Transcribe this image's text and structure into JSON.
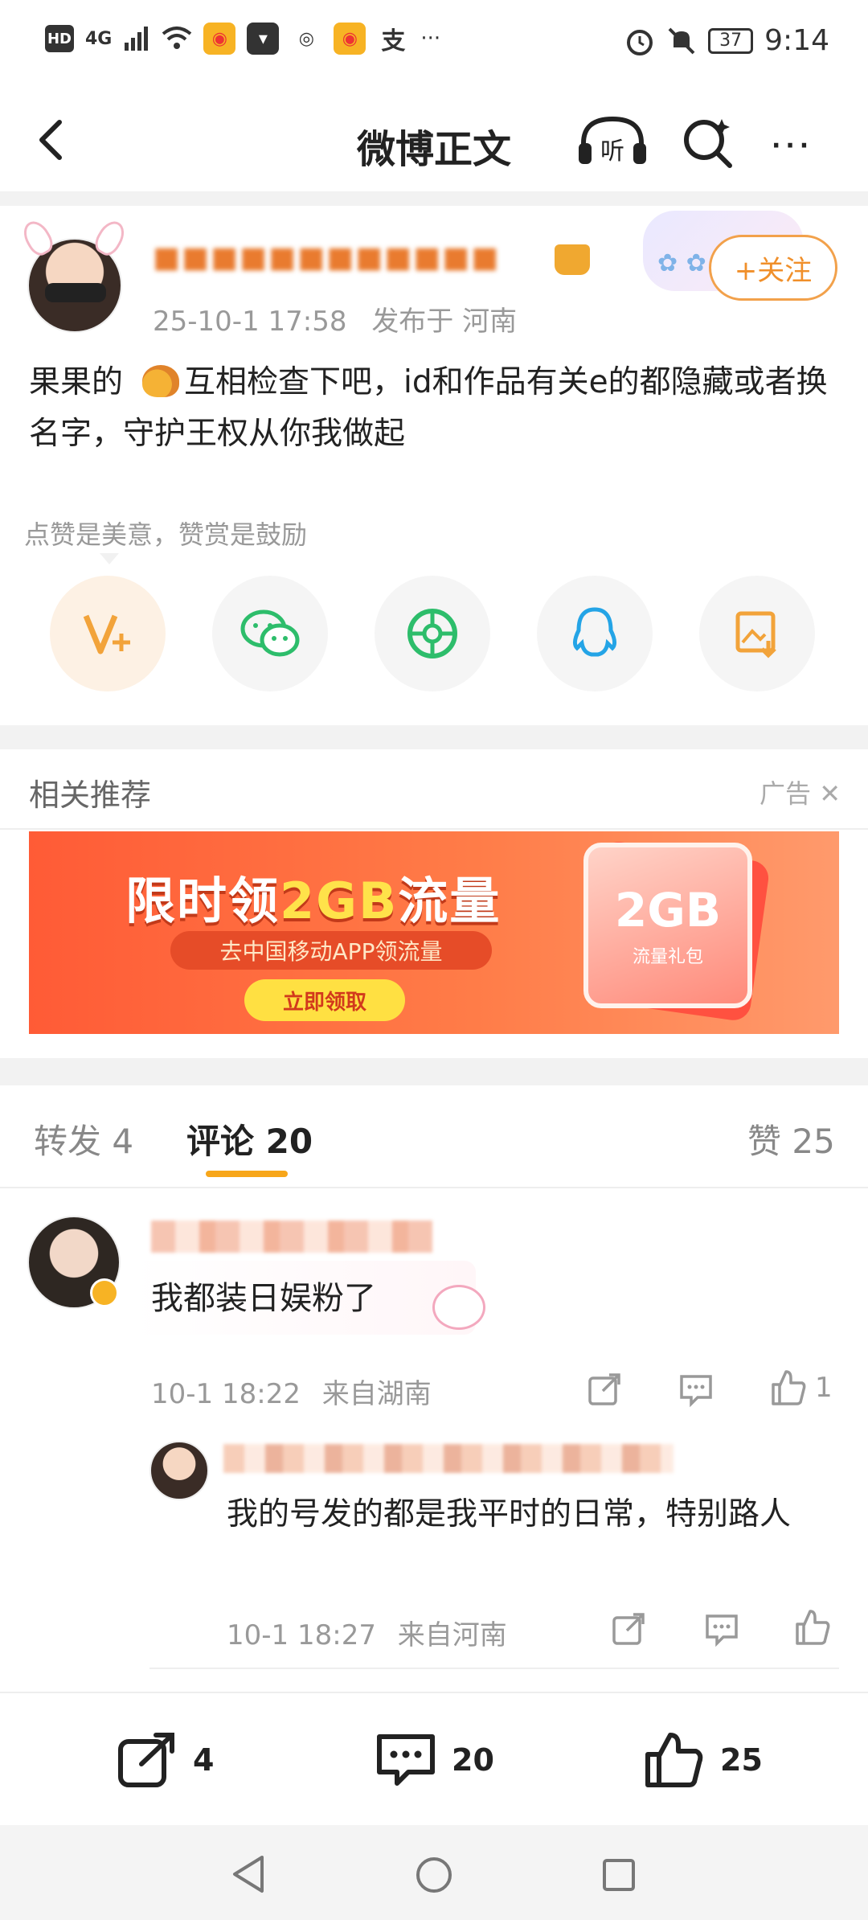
{
  "status_bar": {
    "network": "4G",
    "hd": "HD",
    "battery": "37",
    "time": "9:14",
    "overflow": "···"
  },
  "nav": {
    "title": "微博正文",
    "listen_label": "听",
    "more": "···"
  },
  "post": {
    "meta_time": "25-10-1 17:58",
    "meta_location": "发布于 河南",
    "follow_label": "+关注",
    "text_prefix": "果果的",
    "text_rest": "互相检查下吧，id和作品有关e的都隐藏或者换名字，守护王权从你我做起",
    "tip": "点赞是美意，赞赏是鼓励"
  },
  "recommend": {
    "title": "相关推荐",
    "ad_label": "广告",
    "banner": {
      "title_part1": "限时领",
      "title_highlight": "2GB",
      "title_part2": "流量",
      "subtitle": "去中国移动APP领流量",
      "button": "立即领取",
      "gift_big": "2GB",
      "gift_small": "流量礼包"
    }
  },
  "tabs": [
    {
      "label": "转发",
      "count": "4"
    },
    {
      "label": "评论",
      "count": "20"
    },
    {
      "label": "赞",
      "count": "25"
    }
  ],
  "comments": [
    {
      "text": "我都装日娱粉了",
      "time": "10-1 18:22",
      "location": "来自湖南",
      "likes": "1",
      "reply": {
        "text": "我的号发的都是我平时的日常，特别路人",
        "time": "10-1 18:27",
        "location": "来自河南"
      }
    }
  ],
  "bottom_bar": {
    "repost_count": "4",
    "comment_count": "20",
    "like_count": "25"
  },
  "colors": {
    "accent_orange": "#f7a61a",
    "follow_orange": "#f08f2a",
    "muted_text": "#999999"
  }
}
